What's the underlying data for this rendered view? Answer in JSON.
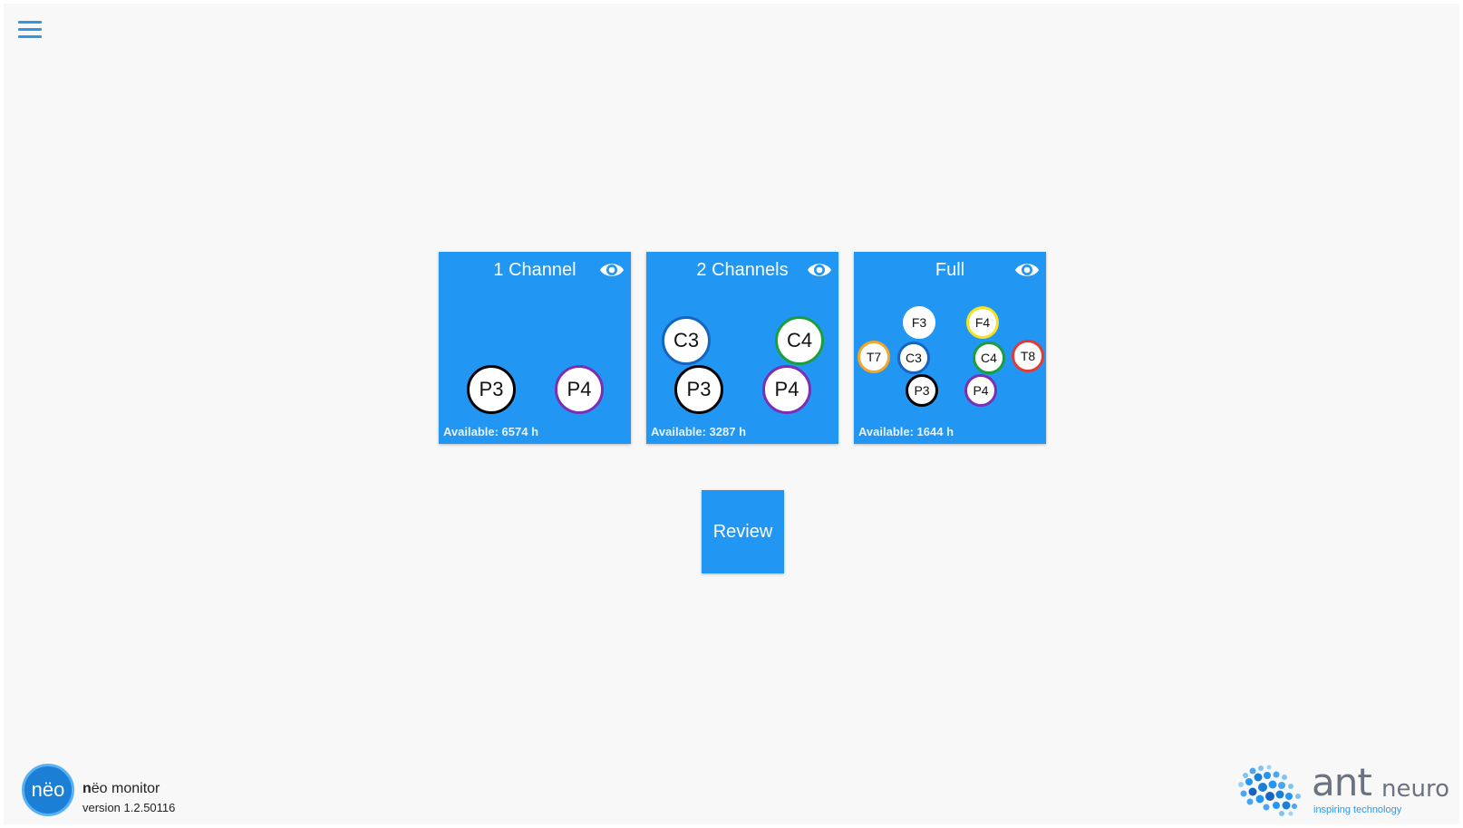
{
  "header": {
    "menu_icon": "hamburger-menu-icon"
  },
  "cards": [
    {
      "title": "1 Channel",
      "available": "Available: 6574 h",
      "view_icon": "eye-icon",
      "electrodes": [
        {
          "label": "P3",
          "ring": "#000000"
        },
        {
          "label": "P4",
          "ring": "#7b2fb5"
        }
      ]
    },
    {
      "title": "2 Channels",
      "available": "Available: 3287 h",
      "view_icon": "eye-icon",
      "electrodes": [
        {
          "label": "C3",
          "ring": "#1565c0"
        },
        {
          "label": "C4",
          "ring": "#1b9e3e"
        },
        {
          "label": "P3",
          "ring": "#000000"
        },
        {
          "label": "P4",
          "ring": "#7b2fb5"
        }
      ]
    },
    {
      "title": "Full",
      "available": "Available: 1644 h",
      "view_icon": "eye-icon",
      "electrodes": [
        {
          "label": "F3",
          "ring": "#ffffff"
        },
        {
          "label": "F4",
          "ring": "#f5e21b"
        },
        {
          "label": "T7",
          "ring": "#f5a623"
        },
        {
          "label": "C3",
          "ring": "#1565c0"
        },
        {
          "label": "C4",
          "ring": "#1b9e3e"
        },
        {
          "label": "T8",
          "ring": "#e53935"
        },
        {
          "label": "P3",
          "ring": "#000000"
        },
        {
          "label": "P4",
          "ring": "#7b2fb5"
        }
      ]
    }
  ],
  "review": {
    "label": "Review"
  },
  "footer": {
    "logo_text": "nëo",
    "app_name_bold": "n",
    "app_name_rest": "ëo monitor",
    "version": "version 1.2.50116",
    "brand_ant": "ant",
    "brand_neuro": "neuro",
    "brand_tagline": "inspiring technology"
  },
  "colors": {
    "accent": "#2196f3",
    "background": "#f8f8f8"
  }
}
